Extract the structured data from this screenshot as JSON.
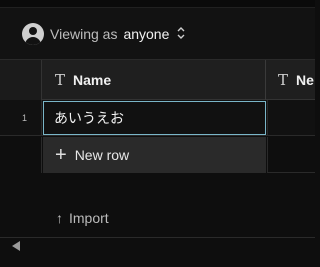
{
  "viewer": {
    "prefix": "Viewing as",
    "user": "anyone",
    "icon": "person-avatar-icon",
    "toggle_icon": "up-down-chevron-icon",
    "toggle_glyph": "⌃⌄"
  },
  "table": {
    "columns": [
      {
        "label": "Name",
        "type_icon": "text-type-icon",
        "type_glyph": "T"
      },
      {
        "label": "Ne",
        "type_icon": "text-type-icon",
        "type_glyph": "T"
      }
    ],
    "rows": [
      {
        "number": "1",
        "name": "あいうえお"
      }
    ],
    "new_row": {
      "label": "New row",
      "icon": "plus-icon",
      "glyph": "+"
    }
  },
  "import": {
    "label": "Import",
    "icon": "arrow-up-icon",
    "glyph": "↑"
  },
  "colors": {
    "accent_border": "#7ab6c8",
    "background": "#0e0e0e",
    "header": "#1f1f1f"
  }
}
